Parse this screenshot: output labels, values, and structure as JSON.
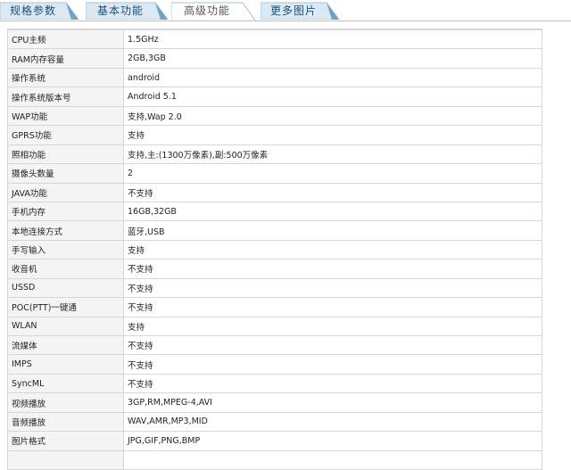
{
  "tabs": [
    {
      "label": "规格参数",
      "active": false
    },
    {
      "label": "基本功能",
      "active": false
    },
    {
      "label": "高级功能",
      "active": true
    },
    {
      "label": "更多图片",
      "active": false
    }
  ],
  "rows": [
    {
      "key": "CPU主频",
      "value": "1.5GHz"
    },
    {
      "key": "RAM内存容量",
      "value": "2GB,3GB"
    },
    {
      "key": "操作系统",
      "value": "android"
    },
    {
      "key": "操作系统版本号",
      "value": "Android 5.1"
    },
    {
      "key": "WAP功能",
      "value": "支持,Wap 2.0"
    },
    {
      "key": "GPRS功能",
      "value": "支持"
    },
    {
      "key": "照相功能",
      "value": "支持,主:(1300万像素),副:500万像素"
    },
    {
      "key": "摄像头数量",
      "value": "2"
    },
    {
      "key": "JAVA功能",
      "value": "不支持"
    },
    {
      "key": "手机内存",
      "value": "16GB,32GB"
    },
    {
      "key": "本地连接方式",
      "value": "蓝牙,USB"
    },
    {
      "key": "手写输入",
      "value": "支持"
    },
    {
      "key": "收音机",
      "value": "不支持"
    },
    {
      "key": "USSD",
      "value": "不支持"
    },
    {
      "key": "POC(PTT)一键通",
      "value": "不支持"
    },
    {
      "key": "WLAN",
      "value": "支持"
    },
    {
      "key": "流媒体",
      "value": "不支持"
    },
    {
      "key": "IMPS",
      "value": "不支持"
    },
    {
      "key": "SyncML",
      "value": "不支持"
    },
    {
      "key": "视频播放",
      "value": "3GP,RM,MPEG-4,AVI"
    },
    {
      "key": "音频播放",
      "value": "WAV,AMR,MP3,MID"
    },
    {
      "key": "图片格式",
      "value": "JPG,GIF,PNG,BMP"
    },
    {
      "key": "",
      "value": ""
    }
  ],
  "colors": {
    "tab_inactive_fill": "#dde9f2",
    "tab_border": "#a9c4d8",
    "tab_corner": "#6aa3c9",
    "tab_active_fill": "#ffffff",
    "key_cell_bg": "#f4f4f4"
  }
}
